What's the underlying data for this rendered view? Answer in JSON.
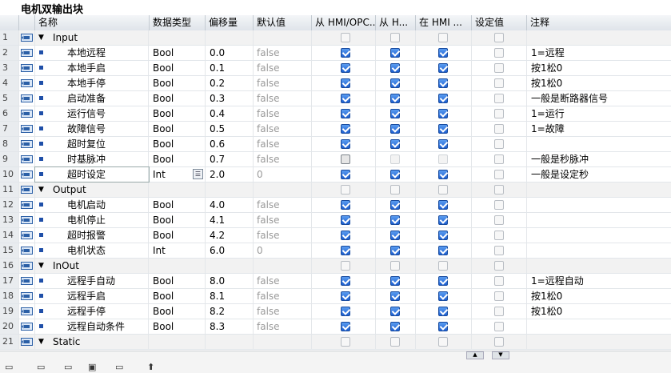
{
  "title": "电机双输出块",
  "columns": [
    "名称",
    "数据类型",
    "偏移量",
    "默认值",
    "从 HMI/OPC..",
    "从 H...",
    "在 HMI ...",
    "设定值",
    "注释"
  ],
  "rows": [
    {
      "no": "1",
      "group": true,
      "name": "Input",
      "type": "",
      "offset": "",
      "def": "",
      "cb": [
        "off",
        "off",
        "off",
        "off"
      ],
      "comment": ""
    },
    {
      "no": "2",
      "name": "本地远程",
      "type": "Bool",
      "offset": "0.0",
      "def": "false",
      "cb": [
        "on",
        "on",
        "on",
        "off"
      ],
      "comment": "1=远程"
    },
    {
      "no": "3",
      "name": "本地手启",
      "type": "Bool",
      "offset": "0.1",
      "def": "false",
      "cb": [
        "on",
        "on",
        "on",
        "off"
      ],
      "comment": "按1松0"
    },
    {
      "no": "4",
      "name": "本地手停",
      "type": "Bool",
      "offset": "0.2",
      "def": "false",
      "cb": [
        "on",
        "on",
        "on",
        "off"
      ],
      "comment": "按1松0"
    },
    {
      "no": "5",
      "name": "启动准备",
      "type": "Bool",
      "offset": "0.3",
      "def": "false",
      "cb": [
        "on",
        "on",
        "on",
        "off"
      ],
      "comment": "一般是断路器信号"
    },
    {
      "no": "6",
      "name": "运行信号",
      "type": "Bool",
      "offset": "0.4",
      "def": "false",
      "cb": [
        "on",
        "on",
        "on",
        "off"
      ],
      "comment": "1=运行"
    },
    {
      "no": "7",
      "name": "故障信号",
      "type": "Bool",
      "offset": "0.5",
      "def": "false",
      "cb": [
        "on",
        "on",
        "on",
        "off"
      ],
      "comment": "1=故障"
    },
    {
      "no": "8",
      "name": "超时复位",
      "type": "Bool",
      "offset": "0.6",
      "def": "false",
      "cb": [
        "on",
        "on",
        "on",
        "off"
      ],
      "comment": ""
    },
    {
      "no": "9",
      "name": "时基脉冲",
      "type": "Bool",
      "offset": "0.7",
      "def": "false",
      "cb": [
        "dark",
        "dis",
        "dis",
        "off"
      ],
      "comment": "一般是秒脉冲"
    },
    {
      "no": "10",
      "name": "超时设定",
      "type": "Int",
      "offset": "2.0",
      "def": "0",
      "cb": [
        "on",
        "on",
        "on",
        "off"
      ],
      "comment": "一般是设定秒",
      "sel": true
    },
    {
      "no": "11",
      "group": true,
      "name": "Output",
      "type": "",
      "offset": "",
      "def": "",
      "cb": [
        "off",
        "off",
        "off",
        "off"
      ],
      "comment": ""
    },
    {
      "no": "12",
      "name": "电机启动",
      "type": "Bool",
      "offset": "4.0",
      "def": "false",
      "cb": [
        "on",
        "on",
        "on",
        "off"
      ],
      "comment": ""
    },
    {
      "no": "13",
      "name": "电机停止",
      "type": "Bool",
      "offset": "4.1",
      "def": "false",
      "cb": [
        "on",
        "on",
        "on",
        "off"
      ],
      "comment": ""
    },
    {
      "no": "14",
      "name": "超时报警",
      "type": "Bool",
      "offset": "4.2",
      "def": "false",
      "cb": [
        "on",
        "on",
        "on",
        "off"
      ],
      "comment": ""
    },
    {
      "no": "15",
      "name": "电机状态",
      "type": "Int",
      "offset": "6.0",
      "def": "0",
      "cb": [
        "on",
        "on",
        "on",
        "off"
      ],
      "comment": ""
    },
    {
      "no": "16",
      "group": true,
      "name": "InOut",
      "type": "",
      "offset": "",
      "def": "",
      "cb": [
        "off",
        "off",
        "off",
        "off"
      ],
      "comment": ""
    },
    {
      "no": "17",
      "name": "远程手自动",
      "type": "Bool",
      "offset": "8.0",
      "def": "false",
      "cb": [
        "on",
        "on",
        "on",
        "off"
      ],
      "comment": "1=远程自动"
    },
    {
      "no": "18",
      "name": "远程手启",
      "type": "Bool",
      "offset": "8.1",
      "def": "false",
      "cb": [
        "on",
        "on",
        "on",
        "off"
      ],
      "comment": "按1松0"
    },
    {
      "no": "19",
      "name": "远程手停",
      "type": "Bool",
      "offset": "8.2",
      "def": "false",
      "cb": [
        "on",
        "on",
        "on",
        "off"
      ],
      "comment": "按1松0"
    },
    {
      "no": "20",
      "name": "远程自动条件",
      "type": "Bool",
      "offset": "8.3",
      "def": "false",
      "cb": [
        "on",
        "on",
        "on",
        "off"
      ],
      "comment": ""
    },
    {
      "no": "21",
      "group": true,
      "name": "Static",
      "type": "",
      "offset": "",
      "def": "",
      "cb": [
        "off",
        "off",
        "off",
        "off"
      ],
      "comment": ""
    }
  ],
  "accent": "#1d5fd0"
}
